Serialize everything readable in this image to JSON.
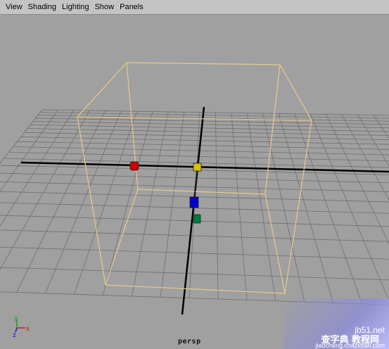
{
  "menubar": {
    "items": [
      {
        "label": "View"
      },
      {
        "label": "Shading"
      },
      {
        "label": "Lighting"
      },
      {
        "label": "Show"
      },
      {
        "label": "Panels"
      }
    ]
  },
  "viewport": {
    "camera_label": "persp",
    "background_color": "#a0a0a0",
    "grid_color": "#6e6e6e",
    "axis_color": "#000000",
    "bounding_box_color": "#e8c98a",
    "axis_indicator": {
      "x_label": "x",
      "y_label": "y",
      "z_label": "z",
      "x_color": "#d01818",
      "y_color": "#18a018",
      "z_color": "#1818d0"
    },
    "manipulators": [
      {
        "name": "red-handle",
        "color": "#cc0000"
      },
      {
        "name": "yellow-handle",
        "color": "#d8c000"
      },
      {
        "name": "blue-handle",
        "color": "#0000cc"
      },
      {
        "name": "green-handle",
        "color": "#007a3c"
      }
    ]
  },
  "watermark": {
    "site": "jb51.net",
    "name": "查字典 教程网",
    "url": "jiaocheng.chazidian.com"
  }
}
